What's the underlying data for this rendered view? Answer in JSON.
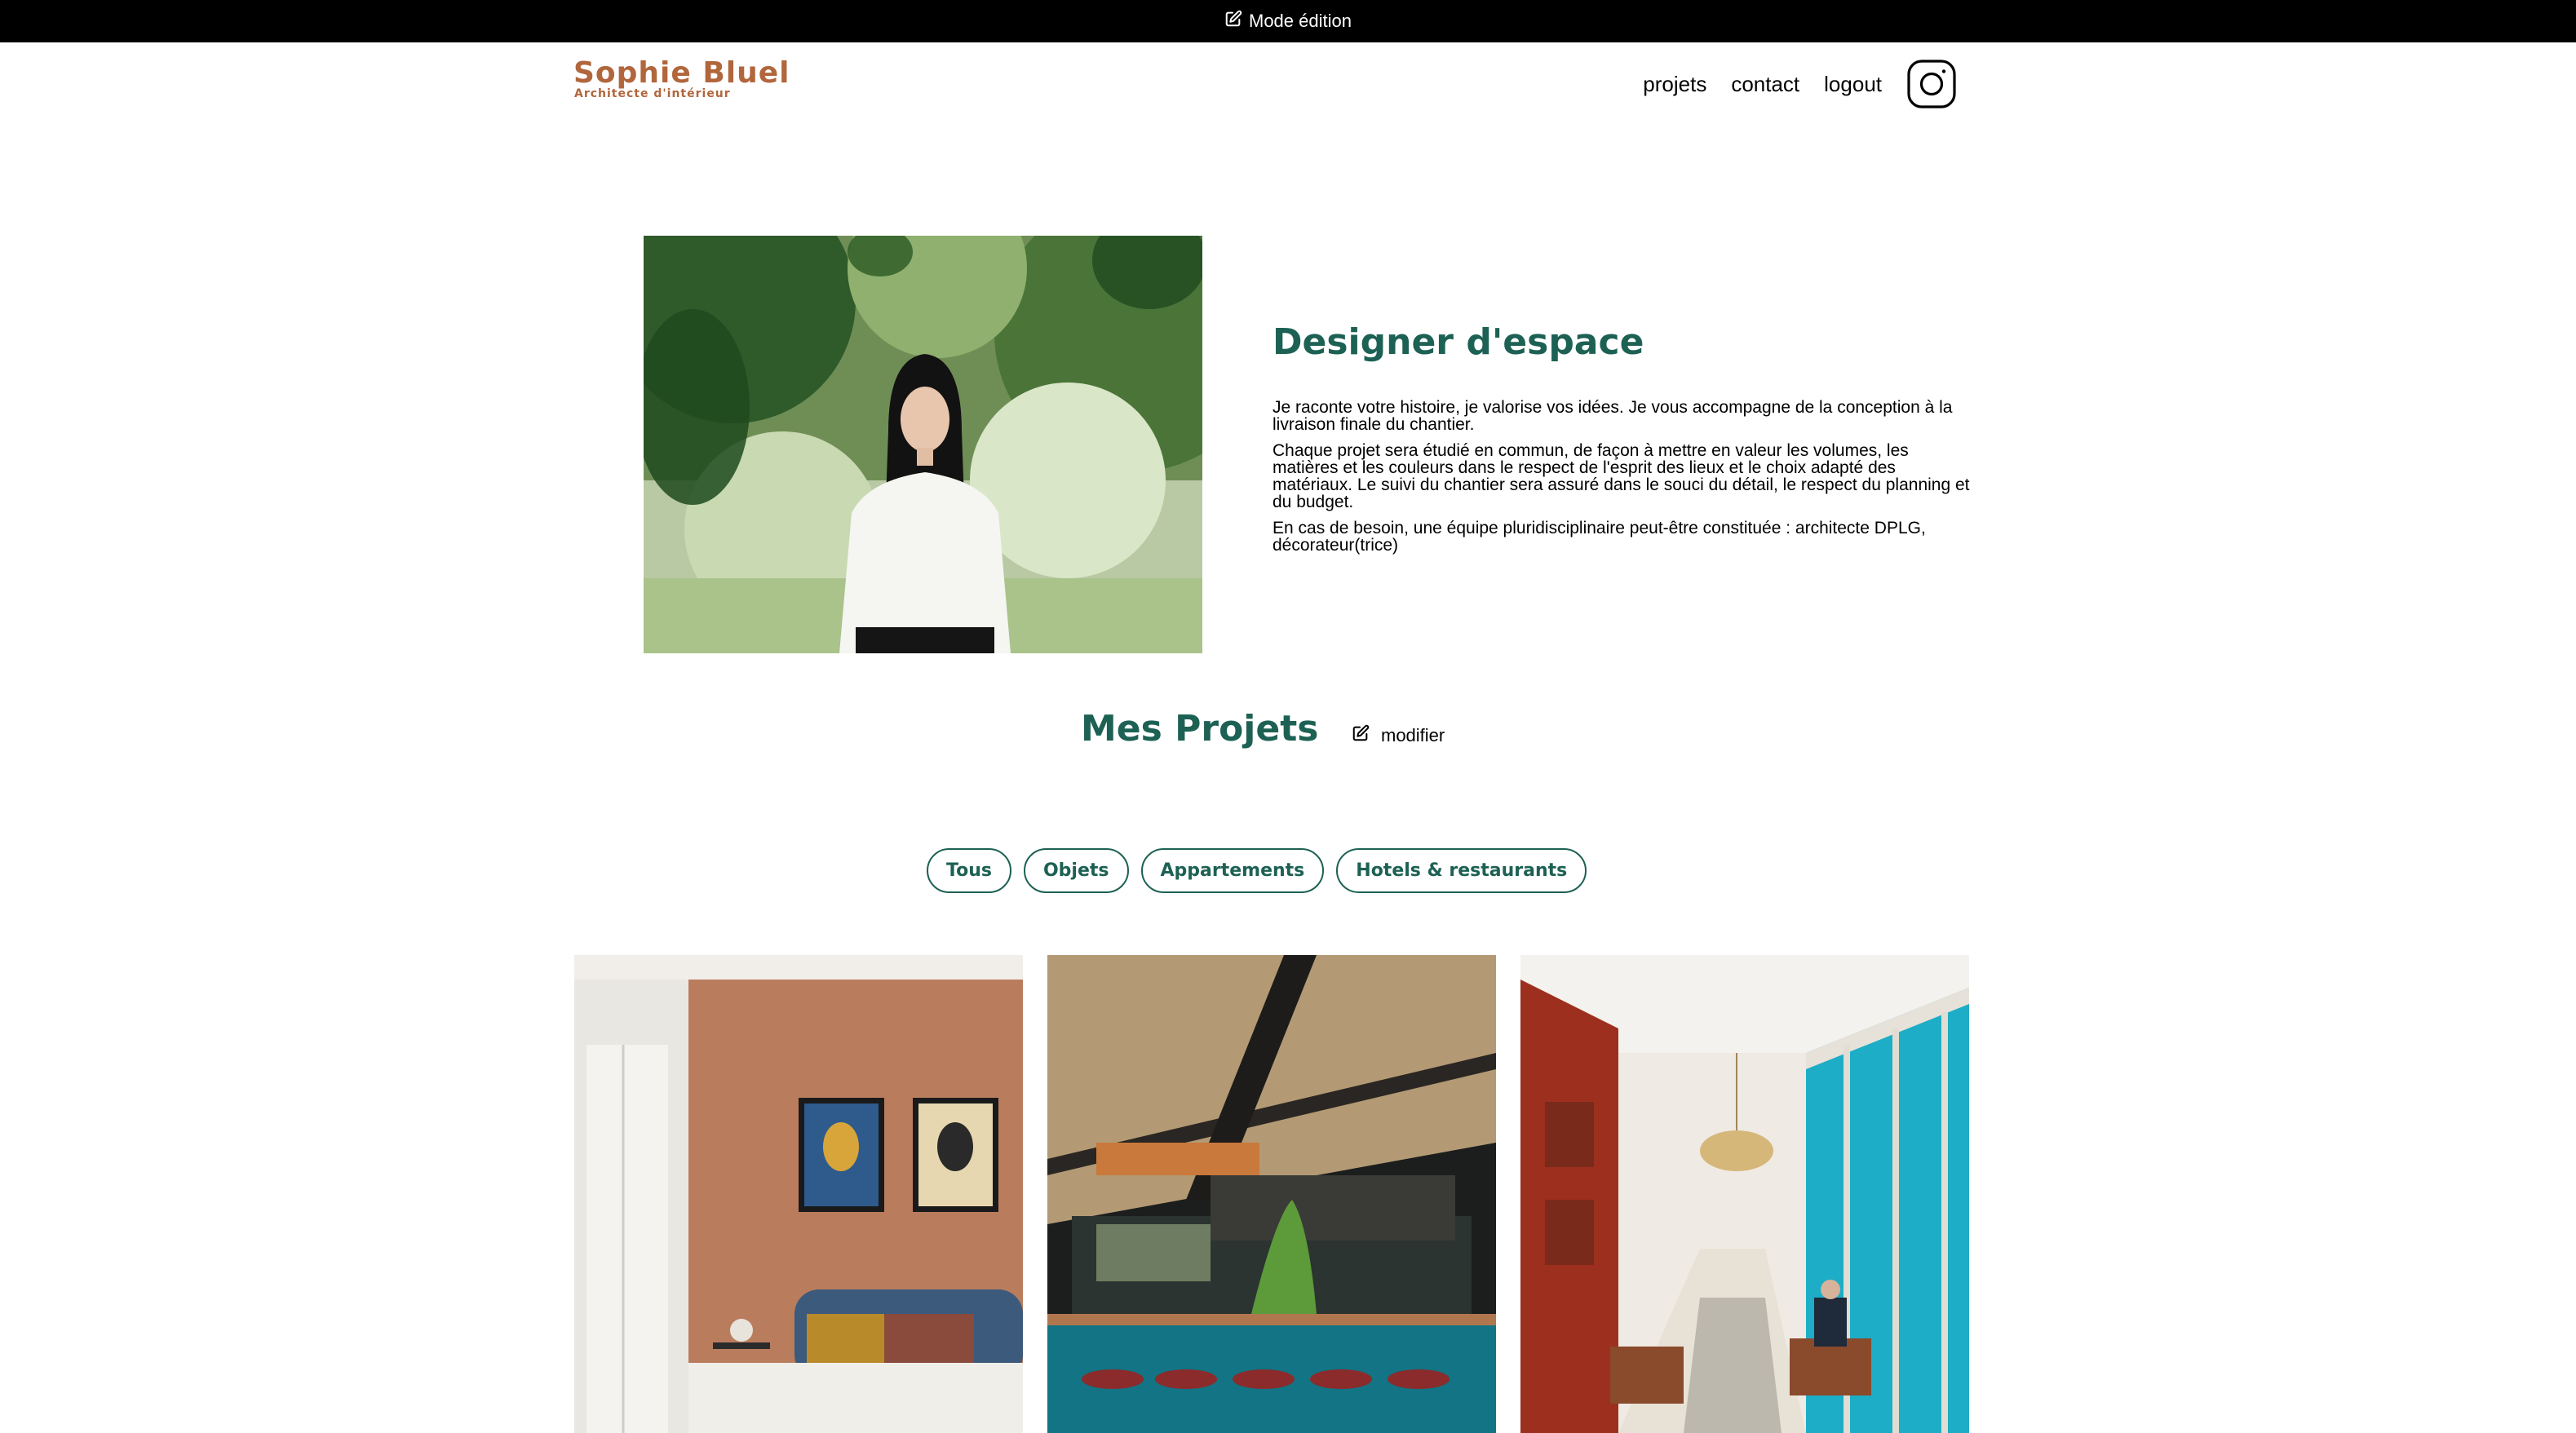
{
  "edit_bar": {
    "label": "Mode édition",
    "icon": "pen-square-icon"
  },
  "header": {
    "logo_title": "Sophie Bluel",
    "logo_subtitle": "Architecte d'intérieur",
    "nav": [
      "projets",
      "contact",
      "logout"
    ],
    "social_icon": "instagram-icon"
  },
  "introduction": {
    "title": "Designer d'espace",
    "paragraphs": [
      "Je raconte votre histoire, je valorise vos idées. Je vous accompagne de la conception à la livraison finale du chantier.",
      "Chaque projet sera étudié en commun, de façon à mettre en valeur les volumes, les matières et les couleurs dans le respect de l'esprit des lieux et le choix adapté des matériaux. Le suivi du chantier sera assuré dans le souci du détail, le respect du planning et du budget.",
      "En cas de besoin, une équipe pluridisciplinaire peut-être constituée : architecte DPLG, décorateur(trice)"
    ]
  },
  "portfolio": {
    "title": "Mes Projets",
    "edit_label": "modifier",
    "filters": [
      "Tous",
      "Objets",
      "Appartements",
      "Hotels & restaurants"
    ]
  },
  "colors": {
    "brand": "#b1663c",
    "accent": "#1d6154",
    "edit_bar": "#000000"
  }
}
